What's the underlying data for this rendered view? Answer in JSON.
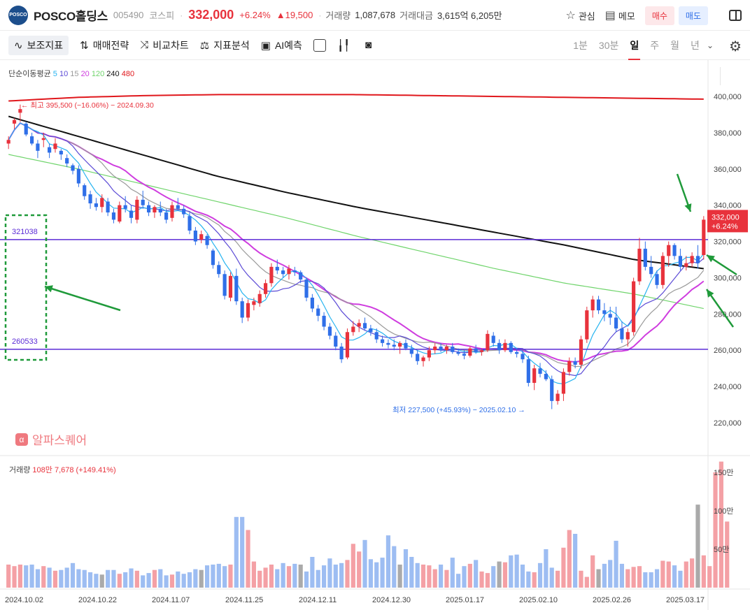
{
  "header": {
    "logo_text": "POSCO",
    "stock_name": "POSCO홀딩스",
    "code": "005490",
    "market": "코스피",
    "price": "332,000",
    "change_pct": "+6.24%",
    "change_amt": "▲19,500",
    "volume_label": "거래량",
    "volume": "1,087,678",
    "amount_label": "거래대금",
    "amount": "3,615억 6,205만",
    "watch_label": "관심",
    "memo_label": "메모",
    "buy_label": "매수",
    "sell_label": "매도"
  },
  "toolbar": {
    "items": [
      "보조지표",
      "매매전략",
      "비교차트",
      "지표분석",
      "AI예측"
    ],
    "periods": [
      "1분",
      "30분",
      "일",
      "주",
      "월",
      "년"
    ],
    "active_period": "일"
  },
  "colors": {
    "up": "#e8323c",
    "down": "#2f6fe8",
    "flat": "#888888",
    "ma5": "#27b4f0",
    "ma10": "#5c4bd6",
    "ma15": "#9a9a9a",
    "ma20": "#cf3ddf",
    "ma120": "#6fd46b",
    "ma240": "#111111",
    "ma480": "#e0171c",
    "level": "#5b2bd6",
    "annotation": "#1f9a3a"
  },
  "indicator_legend": {
    "title": "단순이동평균",
    "periods": [
      "5",
      "10",
      "15",
      "20",
      "120",
      "240",
      "480"
    ]
  },
  "price_axis": [
    "400,000",
    "380,000",
    "360,000",
    "340,000",
    "320,000",
    "300,000",
    "280,000",
    "260,000",
    "240,000",
    "220,000"
  ],
  "high_marker": "최고 395,500 (−16.06%) − 2024.09.30",
  "low_marker": "최저 227,500 (+45.93%) − 2025.02.10",
  "levels": [
    "321038",
    "260533"
  ],
  "current_price_tag": {
    "price": "332,000",
    "pct": "+6.24%"
  },
  "watermark": "알파스퀘어",
  "volume_panel": {
    "label": "거래량",
    "value": "108만 7,678 (+149.41%)",
    "axis": [
      "150만",
      "100만",
      "50만"
    ]
  },
  "date_axis": [
    "2024.10.02",
    "2024.10.22",
    "2024.11.07",
    "2024.11.25",
    "2024.12.11",
    "2024.12.30",
    "2025.01.17",
    "2025.02.10",
    "2025.02.26",
    "2025.03.17"
  ],
  "chart_data": [
    {
      "type": "line",
      "title": "",
      "x": [
        "2024.10.02",
        "2024.10.22",
        "2024.11.07",
        "2024.11.25",
        "2024.12.11",
        "2024.12.30",
        "2025.01.17",
        "2025.02.10",
        "2025.02.26",
        "2025.03.17"
      ],
      "series": [
        {
          "name": "240",
          "values": [
            389000,
            378000,
            367000,
            356000,
            347000,
            339000,
            332000,
            325000,
            318000,
            310000,
            305000
          ]
        },
        {
          "name": "480",
          "values": [
            397500,
            399500,
            400500,
            401000,
            401000,
            401000,
            400500,
            400000,
            399500,
            399000,
            398500
          ]
        },
        {
          "name": "120",
          "values": [
            368000,
            360000,
            351000,
            342000,
            333000,
            323000,
            314000,
            305000,
            297000,
            291000,
            283000
          ]
        }
      ],
      "ylim": [
        210000,
        410000
      ],
      "levels": [
        321038,
        260533
      ],
      "candles_ohlc": [
        [
          374000,
          378000,
          371000,
          376000
        ],
        [
          385000,
          388000,
          382000,
          387000
        ],
        [
          391000,
          395500,
          386000,
          393000
        ],
        [
          385000,
          386000,
          378000,
          379000
        ],
        [
          378000,
          380000,
          373000,
          374000
        ],
        [
          374000,
          376000,
          366000,
          370000
        ],
        [
          376000,
          380000,
          372000,
          377000
        ],
        [
          372000,
          374000,
          366000,
          369000
        ],
        [
          371000,
          377000,
          369000,
          374000
        ],
        [
          370000,
          371000,
          365000,
          368000
        ],
        [
          366000,
          368000,
          361000,
          363000
        ],
        [
          362000,
          363000,
          357000,
          359000
        ],
        [
          360000,
          362000,
          350000,
          352000
        ],
        [
          351000,
          352000,
          343000,
          345000
        ],
        [
          346000,
          348000,
          338000,
          341000
        ],
        [
          341000,
          344000,
          337000,
          339000
        ],
        [
          339000,
          346000,
          336000,
          344000
        ],
        [
          342000,
          344000,
          334000,
          336000
        ],
        [
          336000,
          338000,
          330000,
          332000
        ],
        [
          331000,
          342000,
          330000,
          340000
        ],
        [
          340000,
          345000,
          336000,
          338000
        ],
        [
          337000,
          340000,
          330000,
          333000
        ],
        [
          332000,
          345000,
          330000,
          343000
        ],
        [
          343000,
          348000,
          338000,
          340000
        ],
        [
          340000,
          342000,
          334000,
          336000
        ],
        [
          336000,
          340000,
          333000,
          339000
        ],
        [
          338000,
          342000,
          334000,
          336000
        ],
        [
          336000,
          338000,
          330000,
          332000
        ],
        [
          333000,
          342000,
          331000,
          340000
        ],
        [
          340000,
          344000,
          337000,
          338000
        ],
        [
          338000,
          340000,
          333000,
          335000
        ],
        [
          334000,
          336000,
          324000,
          326000
        ],
        [
          326000,
          328000,
          318000,
          320000
        ],
        [
          321000,
          326000,
          319000,
          324000
        ],
        [
          323000,
          324000,
          316000,
          318000
        ],
        [
          315000,
          316000,
          305000,
          307000
        ],
        [
          307000,
          309000,
          300000,
          302000
        ],
        [
          302000,
          304000,
          288000,
          290000
        ],
        [
          289000,
          303000,
          287000,
          301000
        ],
        [
          301000,
          305000,
          285000,
          287000
        ],
        [
          287000,
          289000,
          275000,
          278000
        ],
        [
          278000,
          288000,
          276000,
          286000
        ],
        [
          285000,
          289000,
          282000,
          287000
        ],
        [
          286000,
          293000,
          284000,
          291000
        ],
        [
          291000,
          299000,
          289000,
          297000
        ],
        [
          297000,
          308000,
          295000,
          306000
        ],
        [
          306000,
          310000,
          302000,
          304000
        ],
        [
          304000,
          306000,
          300000,
          302000
        ],
        [
          302000,
          307000,
          299000,
          305000
        ],
        [
          304000,
          306000,
          301000,
          303000
        ],
        [
          303000,
          304000,
          297000,
          299000
        ],
        [
          299000,
          300000,
          287000,
          289000
        ],
        [
          289000,
          291000,
          281000,
          283000
        ],
        [
          283000,
          285000,
          276000,
          279000
        ],
        [
          279000,
          281000,
          271000,
          273000
        ],
        [
          273000,
          275000,
          266000,
          268000
        ],
        [
          268000,
          270000,
          260000,
          262000
        ],
        [
          262000,
          264000,
          253000,
          255000
        ],
        [
          256000,
          272000,
          255000,
          270000
        ],
        [
          270000,
          276000,
          268000,
          273000
        ],
        [
          273000,
          277000,
          270000,
          275000
        ],
        [
          275000,
          278000,
          271000,
          272000
        ],
        [
          272000,
          274000,
          268000,
          270000
        ],
        [
          270000,
          272000,
          264000,
          266000
        ],
        [
          266000,
          268000,
          262000,
          264000
        ],
        [
          264000,
          266000,
          261000,
          263000
        ],
        [
          263000,
          266000,
          260000,
          262000
        ],
        [
          262000,
          265000,
          258000,
          264000
        ],
        [
          264000,
          266000,
          260000,
          261000
        ],
        [
          261000,
          263000,
          256000,
          258000
        ],
        [
          258000,
          260000,
          252000,
          254000
        ],
        [
          254000,
          257000,
          251000,
          256000
        ],
        [
          256000,
          262000,
          254000,
          260000
        ],
        [
          260000,
          264000,
          258000,
          262000
        ],
        [
          262000,
          264000,
          259000,
          260000
        ],
        [
          260000,
          263000,
          258000,
          262000
        ],
        [
          262000,
          264000,
          258000,
          259000
        ],
        [
          259000,
          261000,
          257000,
          258000
        ],
        [
          258000,
          260000,
          255000,
          257000
        ],
        [
          257000,
          262000,
          256000,
          261000
        ],
        [
          261000,
          263000,
          258000,
          259000
        ],
        [
          259000,
          261000,
          257000,
          260000
        ],
        [
          260000,
          271000,
          259000,
          269000
        ],
        [
          268000,
          270000,
          262000,
          264000
        ],
        [
          264000,
          266000,
          258000,
          260000
        ],
        [
          260000,
          266000,
          259000,
          264000
        ],
        [
          264000,
          265000,
          258000,
          259000
        ],
        [
          259000,
          261000,
          256000,
          258000
        ],
        [
          258000,
          260000,
          253000,
          255000
        ],
        [
          255000,
          257000,
          240000,
          242000
        ],
        [
          242000,
          252000,
          238000,
          250000
        ],
        [
          250000,
          253000,
          245000,
          247000
        ],
        [
          247000,
          249000,
          243000,
          244000
        ],
        [
          244000,
          246000,
          227500,
          232000
        ],
        [
          232000,
          238000,
          230000,
          236000
        ],
        [
          236000,
          250000,
          232000,
          248000
        ],
        [
          248000,
          256000,
          246000,
          254000
        ],
        [
          254000,
          256000,
          250000,
          252000
        ],
        [
          252000,
          268000,
          250000,
          266000
        ],
        [
          266000,
          284000,
          264000,
          282000
        ],
        [
          282000,
          290000,
          278000,
          288000
        ],
        [
          288000,
          290000,
          280000,
          282000
        ],
        [
          282000,
          286000,
          276000,
          280000
        ],
        [
          280000,
          284000,
          274000,
          278000
        ],
        [
          278000,
          284000,
          270000,
          272000
        ],
        [
          272000,
          276000,
          264000,
          266000
        ],
        [
          266000,
          272000,
          262000,
          270000
        ],
        [
          270000,
          300000,
          268000,
          298000
        ],
        [
          298000,
          322000,
          296000,
          316000
        ],
        [
          316000,
          320000,
          304000,
          306000
        ],
        [
          306000,
          312000,
          300000,
          302000
        ],
        [
          302000,
          304000,
          294000,
          296000
        ],
        [
          296000,
          314000,
          294000,
          312000
        ],
        [
          312000,
          320000,
          306000,
          318000
        ],
        [
          318000,
          319000,
          310000,
          312000
        ],
        [
          312000,
          316000,
          304000,
          306000
        ],
        [
          306000,
          312000,
          304000,
          308000
        ],
        [
          308000,
          314000,
          306000,
          312000
        ],
        [
          312000,
          318000,
          305000,
          308000
        ],
        [
          312500,
          334000,
          310000,
          332000
        ]
      ]
    },
    {
      "type": "bar",
      "title": "",
      "ylabel": "거래량",
      "ylim": [
        0,
        1700000
      ],
      "values": [
        300000,
        280000,
        300000,
        290000,
        300000,
        240000,
        280000,
        260000,
        220000,
        230000,
        260000,
        320000,
        240000,
        230000,
        200000,
        180000,
        170000,
        230000,
        230000,
        180000,
        200000,
        250000,
        220000,
        160000,
        190000,
        230000,
        240000,
        160000,
        170000,
        210000,
        180000,
        200000,
        240000,
        230000,
        290000,
        300000,
        310000,
        280000,
        300000,
        920000,
        920000,
        750000,
        340000,
        220000,
        260000,
        300000,
        240000,
        320000,
        280000,
        310000,
        300000,
        210000,
        400000,
        230000,
        290000,
        380000,
        300000,
        320000,
        360000,
        570000,
        470000,
        620000,
        370000,
        330000,
        390000,
        680000,
        540000,
        300000,
        500000,
        400000,
        320000,
        300000,
        290000,
        240000,
        300000,
        230000,
        390000,
        180000,
        280000,
        310000,
        360000,
        210000,
        190000,
        280000,
        340000,
        330000,
        420000,
        430000,
        300000,
        210000,
        200000,
        320000,
        500000,
        260000,
        220000,
        520000,
        750000,
        700000,
        220000,
        140000,
        420000,
        240000,
        310000,
        360000,
        610000,
        310000,
        240000,
        270000,
        280000,
        200000,
        200000,
        240000,
        350000,
        340000,
        290000,
        220000,
        340000,
        380000,
        1080000,
        420000,
        280000,
        1500000,
        1640000,
        860000
      ]
    }
  ]
}
